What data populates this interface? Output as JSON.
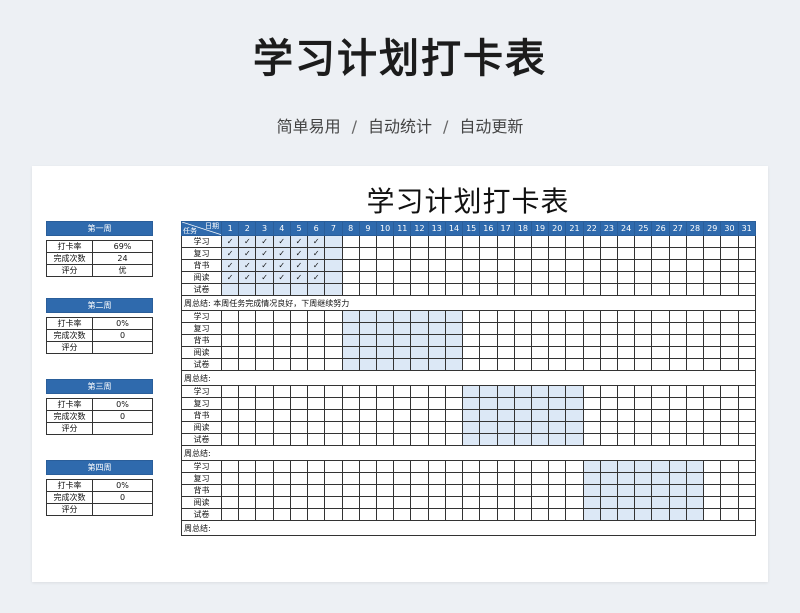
{
  "header": {
    "title": "学习计划打卡表",
    "subtitle_items": [
      "简单易用",
      "自动统计",
      "自动更新"
    ],
    "separator": "/"
  },
  "sheet": {
    "title": "学习计划打卡表",
    "corner_date_label": "日期",
    "corner_task_label": "任务",
    "days": [
      "1",
      "2",
      "3",
      "4",
      "5",
      "6",
      "7",
      "8",
      "9",
      "10",
      "11",
      "12",
      "13",
      "14",
      "15",
      "16",
      "17",
      "18",
      "19",
      "20",
      "21",
      "22",
      "23",
      "24",
      "25",
      "26",
      "27",
      "28",
      "29",
      "30",
      "31"
    ],
    "tasks": [
      "学习",
      "复习",
      "背书",
      "阅读",
      "试卷"
    ],
    "check_mark": "✓",
    "summary_label": "周总结:",
    "weeks": [
      {
        "name": "第一周",
        "highlight_days": [
          1,
          2,
          3,
          4,
          5,
          6,
          7
        ],
        "checked": [
          [
            1,
            2,
            3,
            4,
            5,
            6
          ],
          [
            1,
            2,
            3,
            4,
            5,
            6
          ],
          [
            1,
            2,
            3,
            4,
            5,
            6
          ],
          [
            1,
            2,
            3,
            4,
            5,
            6
          ],
          []
        ],
        "summary": "本周任务完成情况良好，下周继续努力",
        "stats": {
          "rate_label": "打卡率",
          "rate": "69%",
          "count_label": "完成次数",
          "count": "24",
          "score_label": "评分",
          "score": "优"
        }
      },
      {
        "name": "第二周",
        "highlight_days": [
          8,
          9,
          10,
          11,
          12,
          13,
          14
        ],
        "checked": [
          [],
          [],
          [],
          [],
          []
        ],
        "summary": "",
        "stats": {
          "rate_label": "打卡率",
          "rate": "0%",
          "count_label": "完成次数",
          "count": "0",
          "score_label": "评分",
          "score": ""
        }
      },
      {
        "name": "第三周",
        "highlight_days": [
          15,
          16,
          17,
          18,
          19,
          20,
          21
        ],
        "checked": [
          [],
          [],
          [],
          [],
          []
        ],
        "summary": "",
        "stats": {
          "rate_label": "打卡率",
          "rate": "0%",
          "count_label": "完成次数",
          "count": "0",
          "score_label": "评分",
          "score": ""
        }
      },
      {
        "name": "第四周",
        "highlight_days": [
          22,
          23,
          24,
          25,
          26,
          27,
          28
        ],
        "checked": [
          [],
          [],
          [],
          [],
          []
        ],
        "summary": "",
        "stats": {
          "rate_label": "打卡率",
          "rate": "0%",
          "count_label": "完成次数",
          "count": "0",
          "score_label": "评分",
          "score": ""
        }
      }
    ]
  },
  "colors": {
    "header_blue": "#2f6aad",
    "highlight": "#dce8f6",
    "background": "#edf0f4"
  }
}
